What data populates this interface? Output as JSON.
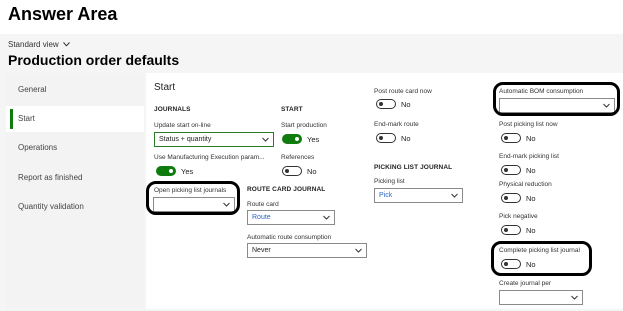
{
  "answer_area": "Answer Area",
  "view": {
    "label": "Standard view"
  },
  "page": {
    "title": "Production order defaults"
  },
  "sidebar": {
    "items": [
      {
        "label": "General"
      },
      {
        "label": "Start"
      },
      {
        "label": "Operations"
      },
      {
        "label": "Report as finished"
      },
      {
        "label": "Quantity validation"
      }
    ]
  },
  "section": {
    "title": "Start"
  },
  "journals": {
    "header": "JOURNALS",
    "update_start_online": {
      "label": "Update start on-line",
      "value": "Status + quantity"
    },
    "use_mes": {
      "label": "Use Manufacturing Execution param...",
      "value": "Yes"
    },
    "open_picking_list_journals": {
      "label": "Open picking list journals",
      "value": ""
    }
  },
  "start": {
    "header": "START",
    "start_production": {
      "label": "Start production",
      "value": "Yes"
    },
    "references": {
      "label": "References",
      "value": "No"
    }
  },
  "route_card_journal": {
    "header": "ROUTE CARD JOURNAL",
    "route_card": {
      "label": "Route card",
      "value": "Route"
    },
    "automatic_route_consumption": {
      "label": "Automatic route consumption",
      "value": "Never"
    }
  },
  "col3": {
    "post_route_card_now": {
      "label": "Post route card now",
      "value": "No"
    },
    "end_mark_route": {
      "label": "End-mark route",
      "value": "No"
    },
    "picking_list_journal_header": "PICKING LIST JOURNAL",
    "picking_list": {
      "label": "Picking list",
      "value": "Pick"
    }
  },
  "col4": {
    "automatic_bom_consumption": {
      "label": "Automatic BOM consumption",
      "value": ""
    },
    "post_picking_list_now": {
      "label": "Post picking list now",
      "value": "No"
    },
    "end_mark_picking_list": {
      "label": "End-mark picking list",
      "value": "No"
    },
    "physical_reduction": {
      "label": "Physical reduction",
      "value": "No"
    },
    "pick_negative": {
      "label": "Pick negative",
      "value": "No"
    },
    "complete_picking_list_journal": {
      "label": "Complete picking list journal",
      "value": "No"
    },
    "create_journal_per": {
      "label": "Create journal per",
      "value": ""
    }
  },
  "colors": {
    "accent": "#107c10",
    "link": "#2b66c4"
  },
  "icons": {
    "chevron": "chevron-down-icon"
  }
}
